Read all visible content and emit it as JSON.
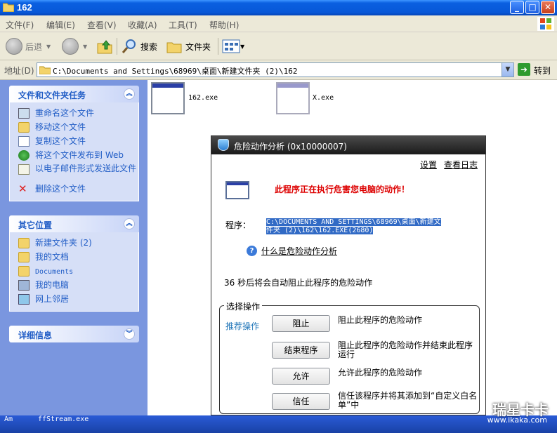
{
  "window": {
    "title": "162"
  },
  "menu": [
    "文件(F)",
    "编辑(E)",
    "查看(V)",
    "收藏(A)",
    "工具(T)",
    "帮助(H)"
  ],
  "toolbar": {
    "back": "后退",
    "search": "搜索",
    "folders": "文件夹"
  },
  "address": {
    "label": "地址(D)",
    "path": "C:\\Documents and Settings\\68969\\桌面\\新建文件夹 (2)\\162",
    "go": "转到"
  },
  "sidebar": {
    "tasks": {
      "title": "文件和文件夹任务",
      "items": [
        "重命名这个文件",
        "移动这个文件",
        "复制这个文件",
        "将这个文件发布到 Web",
        "以电子邮件形式发送此文件",
        "删除这个文件"
      ]
    },
    "places": {
      "title": "其它位置",
      "items": [
        "新建文件夹 (2)",
        "我的文档",
        "Documents",
        "我的电脑",
        "网上邻居"
      ]
    },
    "details": {
      "title": "详细信息"
    }
  },
  "files": [
    {
      "name": "162.exe"
    },
    {
      "name": "X.exe"
    }
  ],
  "taskbar": {
    "left": "Am",
    "item": "ffStream.exe"
  },
  "watermark": {
    "brand": "瑞星卡卡",
    "url": "www.ikaka.com"
  },
  "dialog": {
    "title": "危险动作分析 (0x10000007)",
    "settings": "设置",
    "log": "查看日志",
    "warning": "此程序正在执行危害您电脑的动作！",
    "program_label": "程序：",
    "program_path_1": "C:\\DOCUMENTS AND SETTINGS\\68969\\桌面\\新建文",
    "program_path_2": "件夹 (2)\\162\\162.EXE(2680)",
    "help": "什么是危险动作分析",
    "countdown": "36 秒后将会自动阻止此程序的危险动作",
    "group_label": "选择操作",
    "recommended": "推荐操作",
    "actions": [
      {
        "label": "阻止",
        "desc": "阻止此程序的危险动作"
      },
      {
        "label": "结束程序",
        "desc": "阻止此程序的危险动作并结束此程序运行"
      },
      {
        "label": "允许",
        "desc": "允许此程序的危险动作"
      },
      {
        "label": "信任",
        "desc": "信任该程序并将其添加到“自定义白名单”中"
      }
    ]
  }
}
